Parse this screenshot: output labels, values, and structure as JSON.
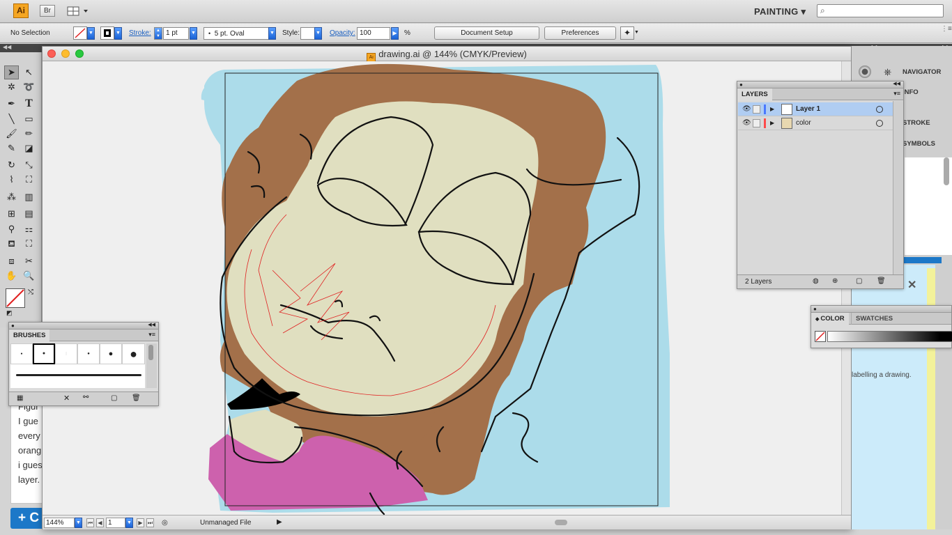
{
  "app_bar": {
    "app_logo": "Ai",
    "bridge_logo": "Br",
    "arrange_icon": "arrange-documents-icon",
    "workspace": "PAINTING ▾",
    "search_placeholder": ""
  },
  "control_bar": {
    "selection": "No Selection",
    "stroke_label": "Stroke:",
    "stroke_weight": "1 pt",
    "brush_value": "5 pt. Oval",
    "style_label": "Style:",
    "opacity_label": "Opacity:",
    "opacity_value": "100",
    "percent": "%",
    "document_setup": "Document Setup",
    "preferences": "Preferences"
  },
  "document": {
    "title": "drawing.ai @ 144% (CMYK/Preview)",
    "zoom": "144%",
    "artboard": "1",
    "status": "Unmanaged File"
  },
  "right_dock": {
    "items": [
      "NAVIGATOR",
      "INFO",
      "STROKE",
      "SYMBOLS"
    ]
  },
  "layers_panel": {
    "tab": "LAYERS",
    "layers": [
      {
        "name": "Layer 1",
        "color": "#4a78ff",
        "selected": true
      },
      {
        "name": "color",
        "color": "#ff4a4a",
        "selected": false
      }
    ],
    "count": "2 Layers"
  },
  "brushes_panel": {
    "tab": "BRUSHES"
  },
  "color_panel": {
    "tabs": [
      "COLOR",
      "SWATCHES"
    ]
  },
  "background_page": {
    "lines": [
      "Figur",
      "I  gue",
      "every",
      "orang",
      "i gues",
      "layer."
    ],
    "note": "labelling a drawing.",
    "button": "+ C"
  },
  "colors": {
    "sky": "#acdcea",
    "hair": "#a3704a",
    "skin": "#e0dfc0",
    "shirt": "#cd61ad",
    "accent_blue": "#1c78c8"
  }
}
